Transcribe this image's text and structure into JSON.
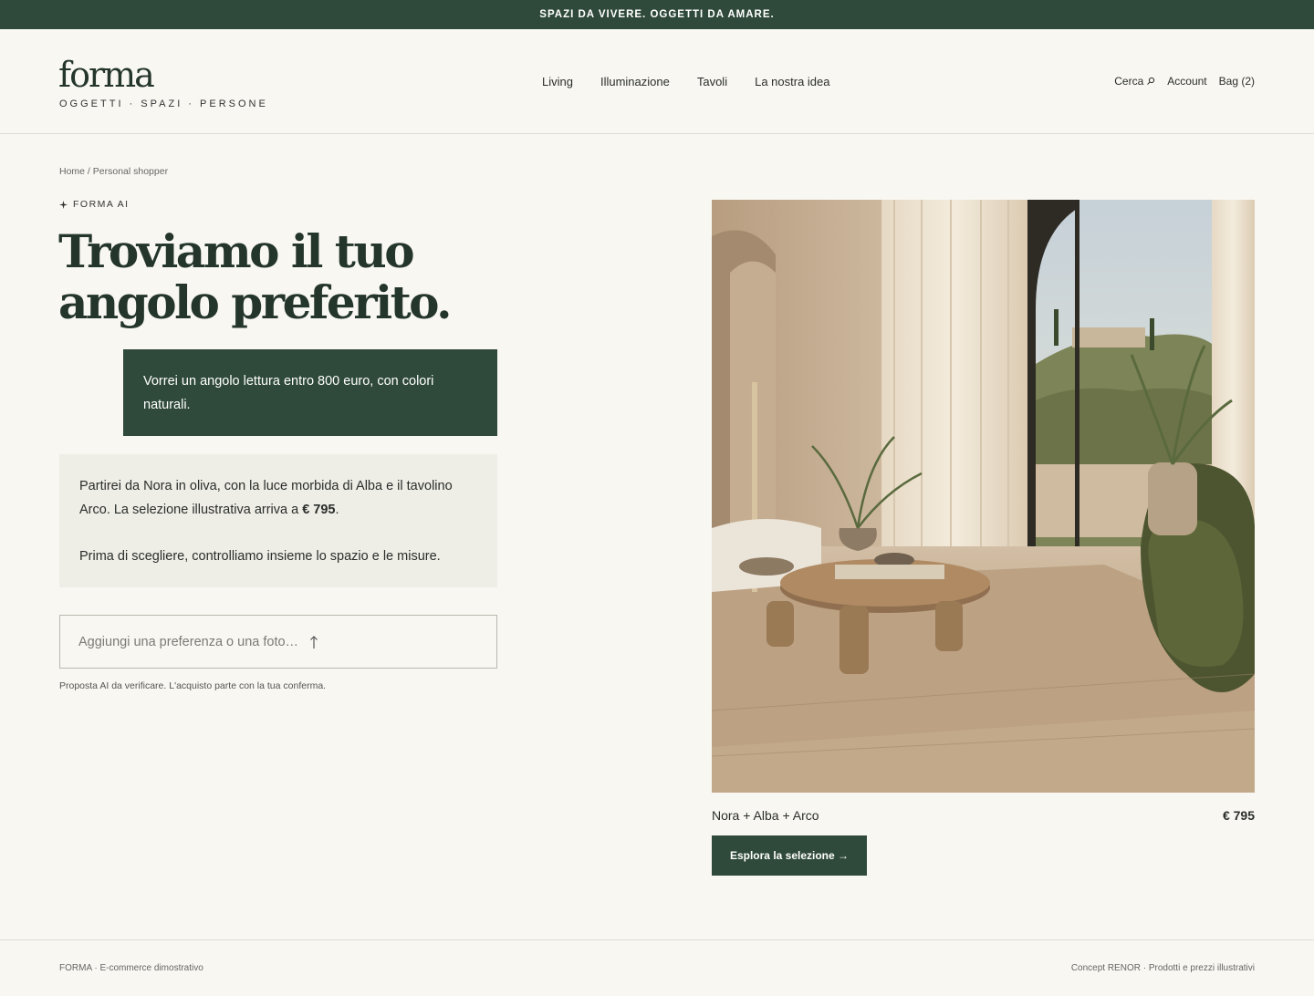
{
  "promo_bar": {
    "text": "SPAZI DA VIVERE. OGGETTI DA AMARE."
  },
  "header": {
    "logo": "forma",
    "tagline": "OGGETTI · SPAZI · PERSONE",
    "nav": [
      "Living",
      "Illuminazione",
      "Tavoli",
      "La nostra idea"
    ],
    "utility": {
      "search": "Cerca",
      "search_icon": "search-icon",
      "account": "Account",
      "bag": "Bag (2)"
    }
  },
  "breadcrumb": "Home / Personal shopper",
  "eyebrow": {
    "icon": "sparkle-icon",
    "text": "FORMA AI"
  },
  "headline": {
    "line1": "Troviamo il tuo",
    "line2": "angolo preferito."
  },
  "chat": {
    "user_message": "Vorrei un angolo lettura entro 800 euro, con colori naturali.",
    "ai_message": {
      "before_price": "Partirei da Nora in oliva, con la luce morbida di Alba e il tavolino Arco. La selezione illustrativa arriva a ",
      "price": "€ 795",
      "after_price": ".",
      "second_paragraph": "Prima di scegliere, controlliamo insieme lo spazio e le misure."
    },
    "input_placeholder": "Aggiungi una preferenza o una foto…",
    "upload_icon": "arrow-up-icon",
    "disclaimer": "Proposta AI da verificare. L'acquisto parte con la tua conferma."
  },
  "selection": {
    "name": "Nora + Alba + Arco",
    "price": "€ 795",
    "cta": "Esplora la selezione →"
  },
  "footer": {
    "left": "FORMA · E-commerce dimostrativo",
    "right": "Concept RENOR · Prodotti e prezzi illustrativi"
  },
  "colors": {
    "brand_green": "#2f4a3a",
    "background": "#f9f7f2",
    "ai_bubble": "#eeede6"
  }
}
